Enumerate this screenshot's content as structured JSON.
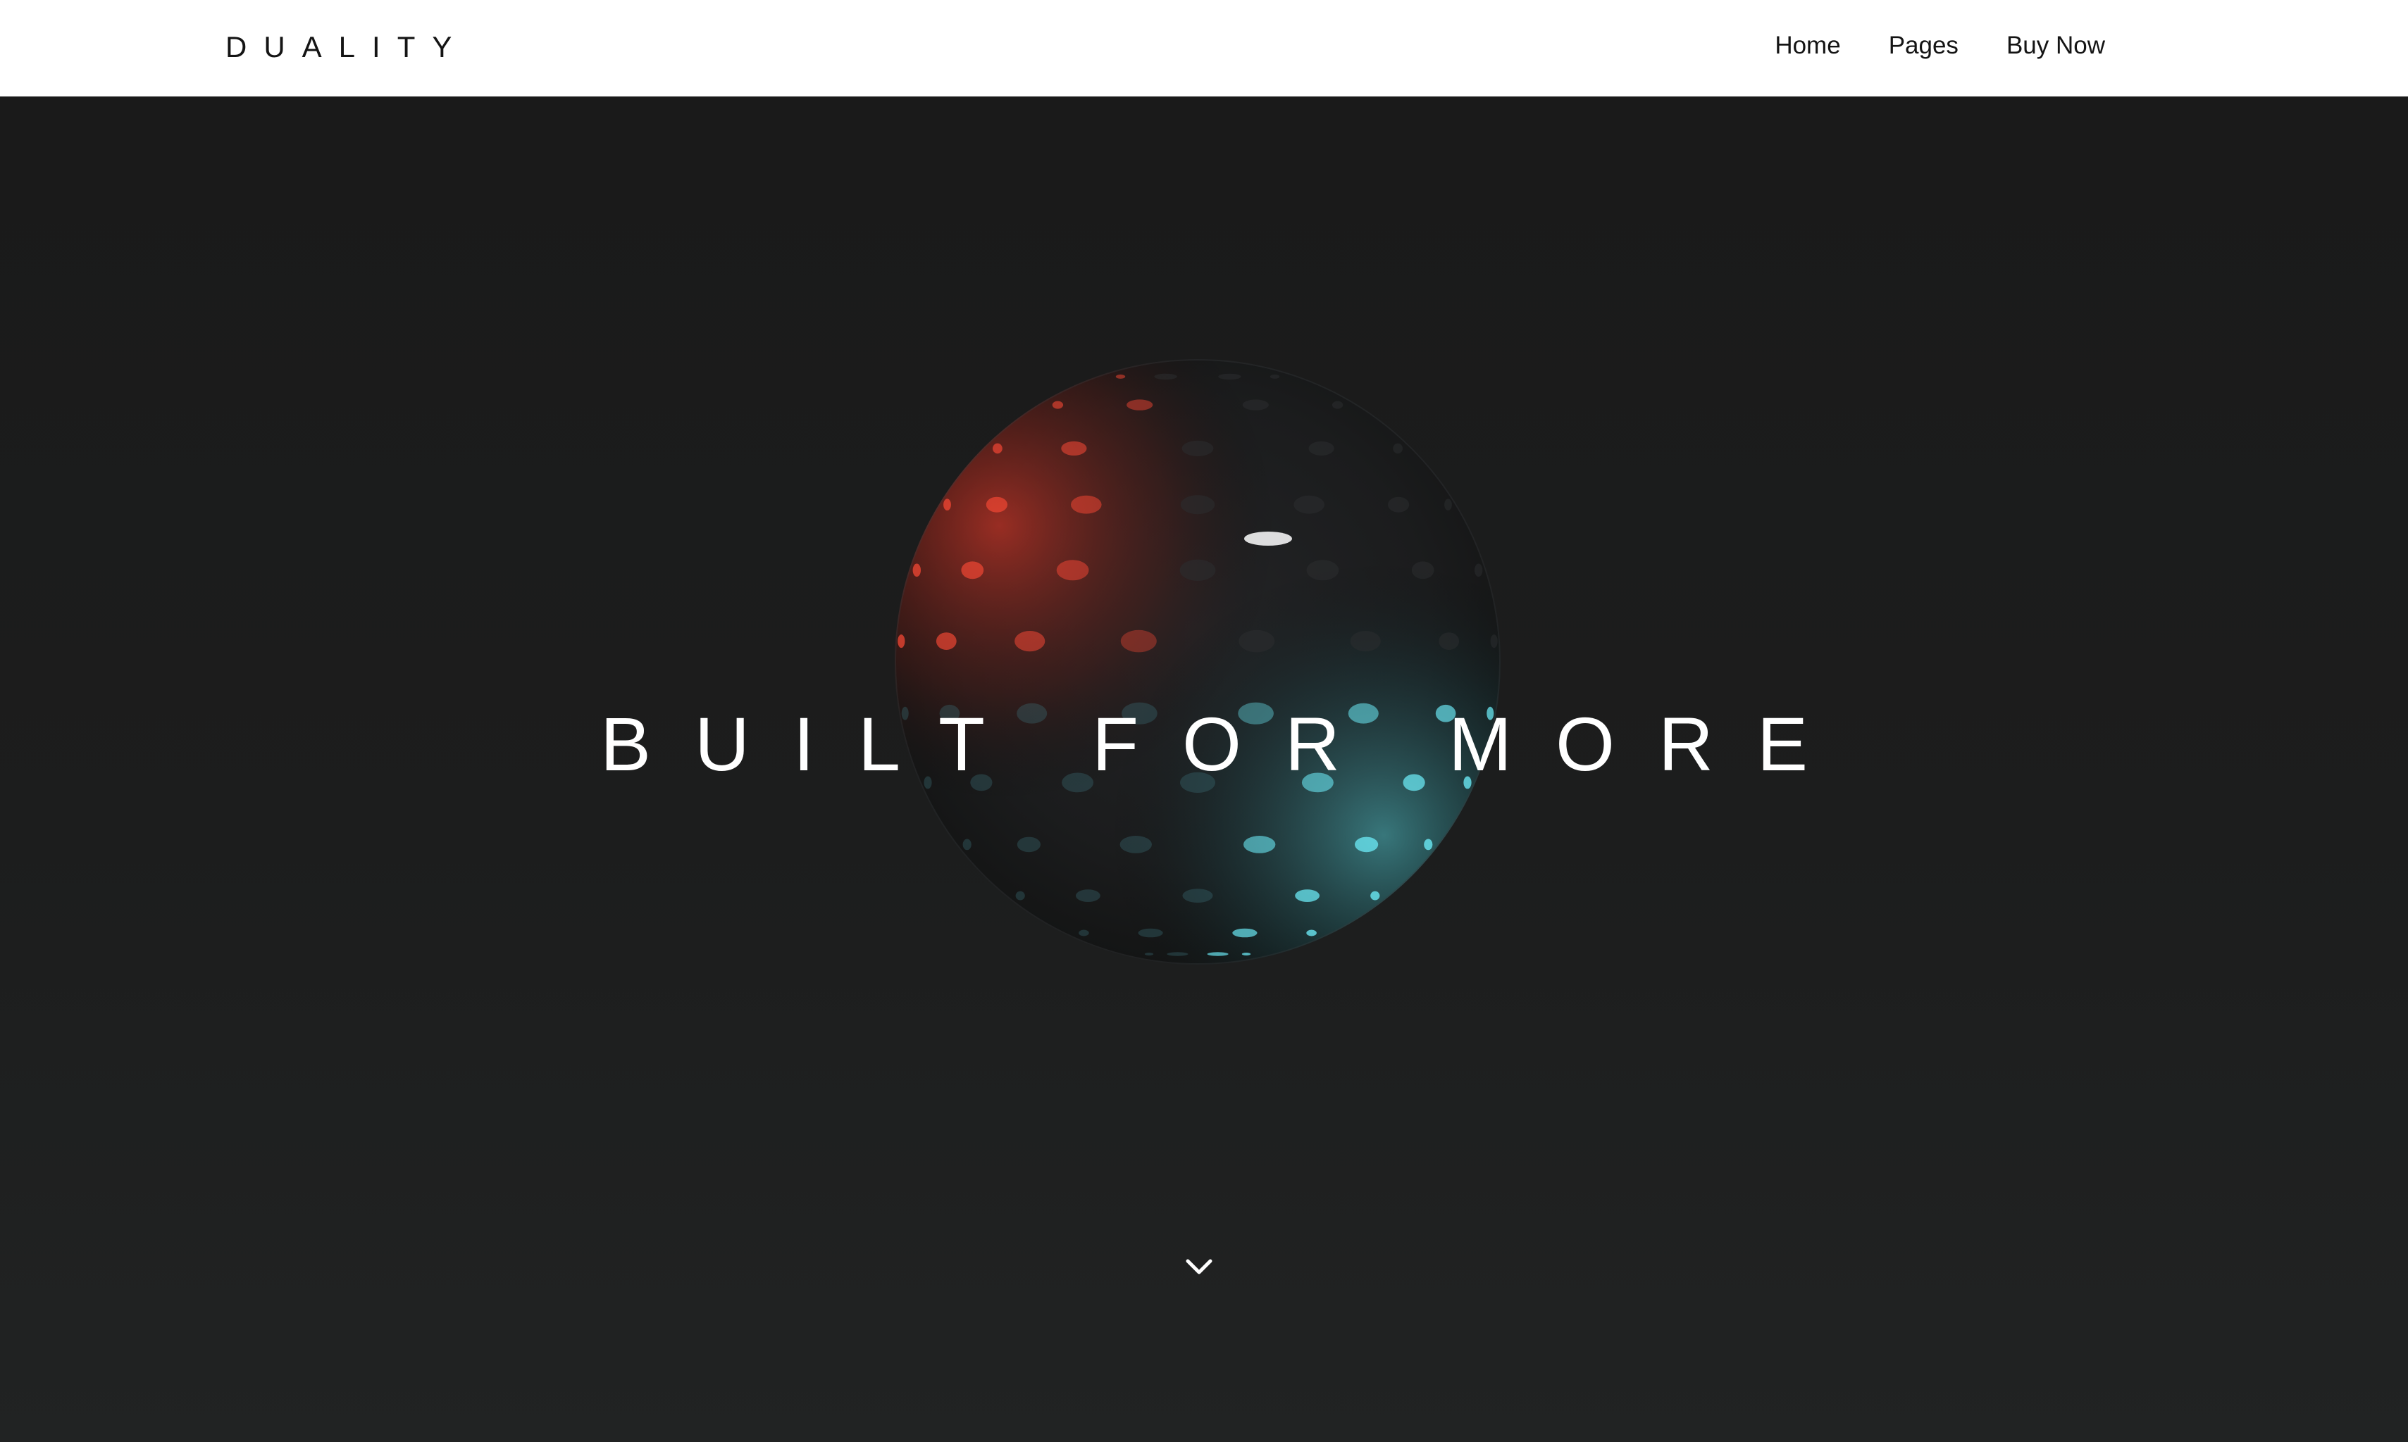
{
  "nav": {
    "logo": "DUALITY",
    "links": [
      {
        "label": "Home"
      },
      {
        "label": "Pages"
      },
      {
        "label": "Buy Now"
      }
    ]
  },
  "hero": {
    "headline": "BUILT FOR MORE",
    "scroll_icon": "chevron-down-icon",
    "sphere_icon": "dimpled-sphere-graphic"
  },
  "colors": {
    "navbar_bg": "#ffffff",
    "hero_bg": "#1c1d1e",
    "text_light": "#ffffff",
    "text_dark": "#141414",
    "accent_red": "#ff4a36",
    "accent_cyan": "#6ff3ff"
  }
}
